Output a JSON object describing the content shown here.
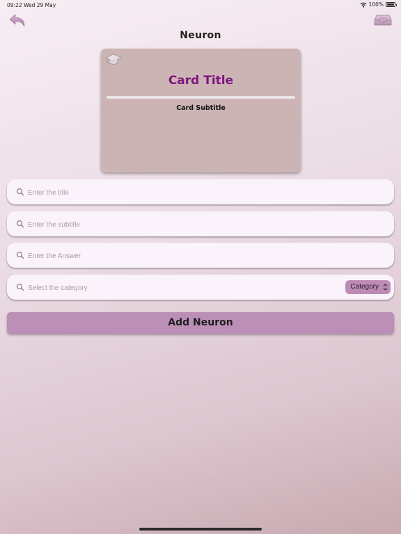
{
  "status_bar": {
    "time": "09:22",
    "date": "Wed 29 May",
    "battery": "100%",
    "battery_level": 1.0
  },
  "nav": {
    "title": "Neuron",
    "back_icon": "back-arrow-icon",
    "drawer_icon": "tray-icon"
  },
  "card": {
    "title": "Card Title",
    "subtitle": "Card Subtitle",
    "progress": 1.0,
    "icon": "graduation-cap-icon"
  },
  "form": {
    "title_placeholder": "Enter the title",
    "subtitle_placeholder": "Enter the subtitle",
    "answer_placeholder": "Enter the Answer",
    "category_placeholder": "Select the category",
    "category_button": "Category"
  },
  "actions": {
    "add_label": "Add Neuron"
  },
  "colors": {
    "accent": "#bb8fb6",
    "card_bg": "#ccb4b4",
    "card_title": "#7d1480",
    "field_bg": "#fbf3fb"
  }
}
